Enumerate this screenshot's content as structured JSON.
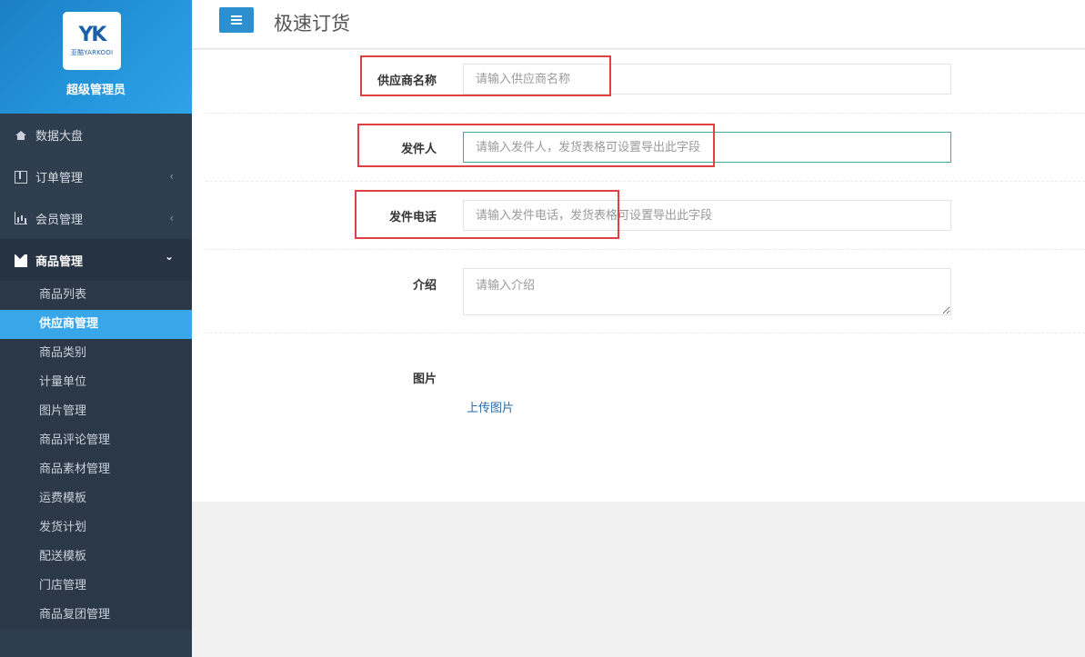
{
  "brand": {
    "logo_mark": "YK",
    "logo_sub": "亚酷YARKOOI",
    "title": "超级管理员"
  },
  "sidebar": {
    "items": [
      {
        "label": "数据大盘",
        "icon": "home-icon"
      },
      {
        "label": "订单管理",
        "icon": "columns-icon",
        "caret": "‹"
      },
      {
        "label": "会员管理",
        "icon": "bar-chart-icon",
        "caret": "‹"
      },
      {
        "label": "商品管理",
        "icon": "envelope-icon",
        "caret": "⌄"
      }
    ],
    "sub_items": [
      {
        "label": "商品列表"
      },
      {
        "label": "供应商管理",
        "active": true
      },
      {
        "label": "商品类别"
      },
      {
        "label": "计量单位"
      },
      {
        "label": "图片管理"
      },
      {
        "label": "商品评论管理"
      },
      {
        "label": "商品素材管理"
      },
      {
        "label": "运费模板"
      },
      {
        "label": "发货计划"
      },
      {
        "label": "配送模板"
      },
      {
        "label": "门店管理"
      },
      {
        "label": "商品复团管理"
      }
    ]
  },
  "header": {
    "title": "极速订货"
  },
  "form": {
    "supplier_name": {
      "label": "供应商名称",
      "placeholder": "请输入供应商名称",
      "value": ""
    },
    "sender": {
      "label": "发件人",
      "placeholder": "请输入发件人，发货表格可设置导出此字段",
      "value": ""
    },
    "sender_phone": {
      "label": "发件电话",
      "placeholder": "请输入发件电话，发货表格可设置导出此字段",
      "value": ""
    },
    "intro": {
      "label": "介绍",
      "placeholder": "请输入介绍",
      "value": ""
    },
    "image": {
      "label": "图片",
      "upload_label": "上传图片"
    }
  },
  "colors": {
    "sidebar_bg": "#2f3e4f",
    "brand_blue": "#2596dc",
    "active_item": "#3aa6ea",
    "annotation_red": "#e04141"
  }
}
